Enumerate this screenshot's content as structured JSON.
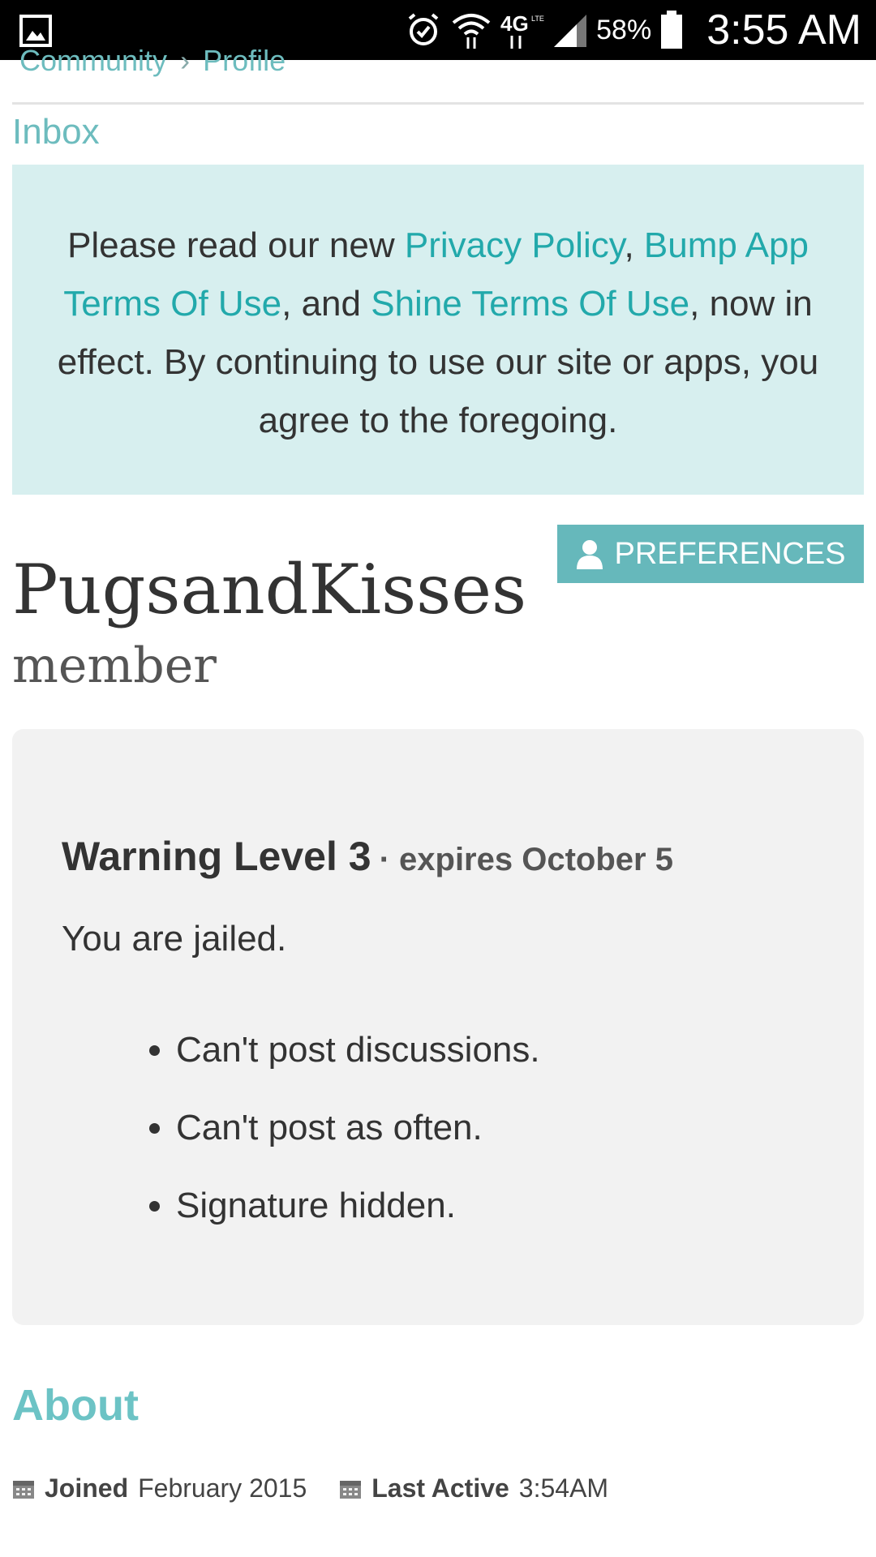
{
  "status_bar": {
    "battery_percent": "58%",
    "time": "3:55 AM",
    "network": "4G LTE",
    "icons": [
      "gallery-icon",
      "alarm-icon",
      "wifi-icon",
      "lte-icon",
      "signal-icon",
      "battery-icon"
    ]
  },
  "breadcrumb": {
    "items": [
      "Community",
      "Profile"
    ],
    "separator": "›"
  },
  "inbox": {
    "label": "Inbox"
  },
  "notice": {
    "text_1": "Please read our new ",
    "link_privacy": "Privacy Policy",
    "text_2": ", ",
    "link_bump": "Bump App Terms Of Use",
    "text_3": ", and ",
    "link_shine": "Shine Terms Of Use",
    "text_4": ", now in effect. By continuing to use our site or apps, you agree to the foregoing."
  },
  "profile": {
    "username": "PugsandKisses",
    "role": "member",
    "preferences_label": "PREFERENCES"
  },
  "warning": {
    "title": "Warning Level 3",
    "expiry": "· expires October 5",
    "status": "You are jailed.",
    "restrictions": [
      "Can't post discussions.",
      "Can't post as often.",
      "Signature hidden."
    ]
  },
  "about": {
    "heading": "About",
    "joined_label": "Joined",
    "joined_value": "February 2015",
    "last_active_label": "Last Active",
    "last_active_value": "3:54AM"
  },
  "colors": {
    "accent": "#66b8bb",
    "link": "#22a9ab",
    "notice_bg": "#d7efef",
    "card_bg": "#f2f2f2",
    "status_bar_bg": "#000000"
  }
}
